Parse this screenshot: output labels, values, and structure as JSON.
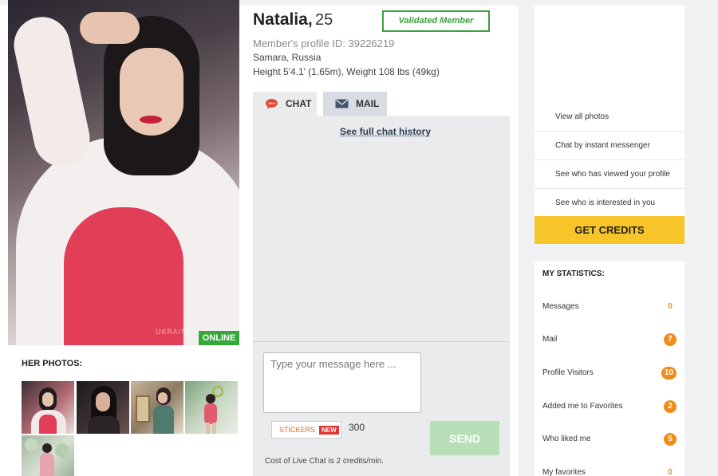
{
  "profile": {
    "name": "Natalia,",
    "age": "25",
    "validated_label": "Validated Member",
    "profile_id": "Member's profile ID: 39226219",
    "location": "Samara, Russia",
    "measurements": "Height 5'4.1' (1.65m), Weight 108 lbs (49kg)",
    "online_label": "ONLINE",
    "watermark": "UKRAINE"
  },
  "photos": {
    "title": "HER PHOTOS:"
  },
  "tabs": [
    {
      "label": "CHAT",
      "icon": "chat-bubble-icon",
      "color": "#e0493c"
    },
    {
      "label": "MAIL",
      "icon": "envelope-icon",
      "color": "#45556e"
    }
  ],
  "chat": {
    "history_link": "See full chat history",
    "input_placeholder": "Type your message here ...",
    "stickers_label": "STICKERS",
    "new_badge": "NEW",
    "char_count": "300",
    "send_label": "SEND",
    "cost_note": "Cost of Live Chat is 2 credits/min."
  },
  "actions": {
    "items": [
      "View all photos",
      "Chat by instant messenger",
      "See who has viewed your profile",
      "See who is interested in you"
    ],
    "credits_label": "GET CREDITS",
    "credits_color": "#f7c42a"
  },
  "stats": {
    "title": "MY STATISTICS:",
    "rows": [
      {
        "label": "Messages",
        "count": "0"
      },
      {
        "label": "Mail",
        "count": "7"
      },
      {
        "label": "Profile Visitors",
        "count": "10"
      },
      {
        "label": "Added me to Favorites",
        "count": "2"
      },
      {
        "label": "Who liked me",
        "count": "5"
      },
      {
        "label": "My favorites",
        "count": "0"
      }
    ],
    "badge_color": "#f08c1c"
  },
  "colors": {
    "online_green": "#35a83a",
    "validated_green": "#3aa13d",
    "send_disabled": "#b9dfb9"
  }
}
